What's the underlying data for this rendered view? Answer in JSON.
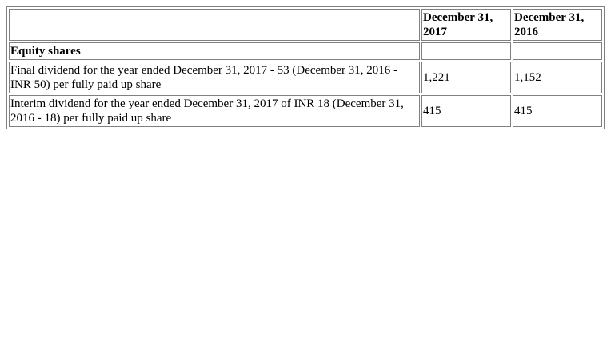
{
  "table": {
    "headers": [
      "",
      "December 31, 2017",
      "December 31, 2016"
    ],
    "section_label": "Equity shares",
    "rows": [
      {
        "label": "Final dividend for the year ended December 31, 2017 - 53 (December 31, 2016 - INR 50) per fully paid up share",
        "values": [
          "1,221",
          "1,152"
        ]
      },
      {
        "label": "Interim dividend for the year ended December 31, 2017 of INR 18 (December 31, 2016 - 18) per fully paid up share",
        "values": [
          "415",
          "415"
        ]
      }
    ]
  }
}
